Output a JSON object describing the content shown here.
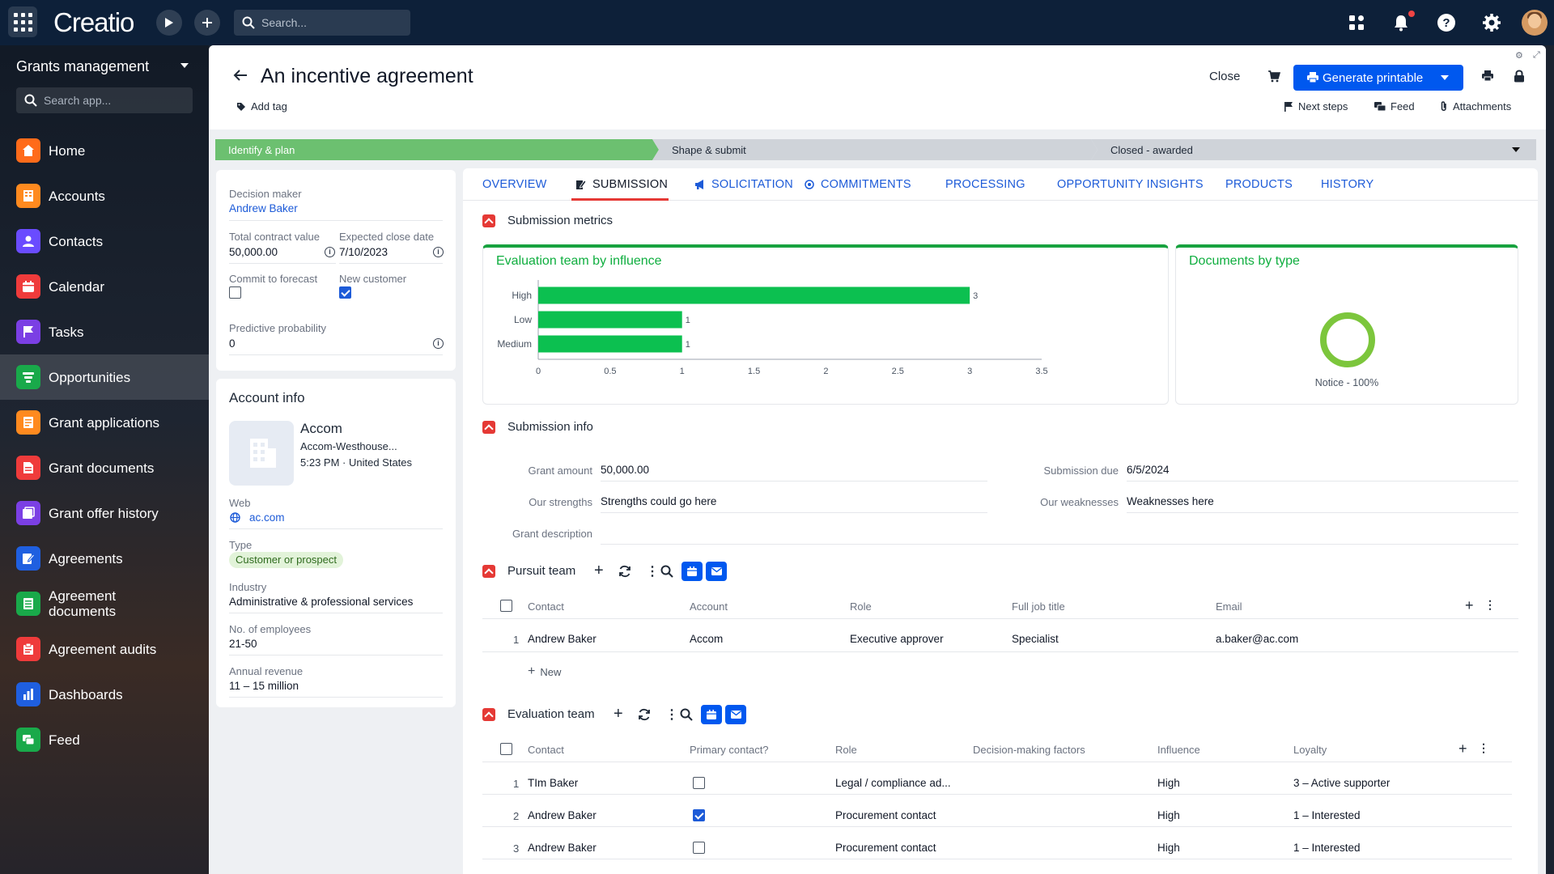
{
  "topbar": {
    "logo": "Creatio",
    "search_placeholder": "Search..."
  },
  "sidebar": {
    "app_name": "Grants management",
    "search_placeholder": "Search app...",
    "items": [
      {
        "label": "Home",
        "icon": "home-icon",
        "color": "#ff6b1a"
      },
      {
        "label": "Accounts",
        "icon": "building-icon",
        "color": "#ff8a1f"
      },
      {
        "label": "Contacts",
        "icon": "person-icon",
        "color": "#6a4cff"
      },
      {
        "label": "Calendar",
        "icon": "calendar-icon",
        "color": "#ef3b3b"
      },
      {
        "label": "Tasks",
        "icon": "flag-icon",
        "color": "#7b3fe4"
      },
      {
        "label": "Opportunities",
        "icon": "funnel-icon",
        "color": "#19a94a"
      },
      {
        "label": "Grant applications",
        "icon": "form-icon",
        "color": "#ff8a1f"
      },
      {
        "label": "Grant documents",
        "icon": "document-icon",
        "color": "#ef3b3b"
      },
      {
        "label": "Grant offer history",
        "icon": "history-icon",
        "color": "#7b3fe4"
      },
      {
        "label": "Agreements",
        "icon": "edit-icon",
        "color": "#1f5fe0"
      },
      {
        "label": "Agreement documents",
        "icon": "doc-list-icon",
        "color": "#19a94a"
      },
      {
        "label": "Agreement audits",
        "icon": "audit-icon",
        "color": "#ef3b3b"
      },
      {
        "label": "Dashboards",
        "icon": "bar-chart-icon",
        "color": "#1f5fe0"
      },
      {
        "label": "Feed",
        "icon": "chat-icon",
        "color": "#19a94a"
      }
    ]
  },
  "header": {
    "title": "An incentive agreement",
    "add_tag": "Add tag",
    "close": "Close",
    "generate": "Generate printable",
    "next_steps": "Next steps",
    "feed": "Feed",
    "attachments": "Attachments"
  },
  "stages": [
    "Identify & plan",
    "Shape & submit",
    "Closed - awarded"
  ],
  "left_panel": {
    "decision_maker_label": "Decision maker",
    "decision_maker": "Andrew Baker",
    "total_contract_label": "Total contract value",
    "total_contract": "50,000.00",
    "expected_close_label": "Expected close date",
    "expected_close": "7/10/2023",
    "commit_label": "Commit to forecast",
    "commit": false,
    "new_customer_label": "New customer",
    "new_customer": true,
    "predictive_label": "Predictive probability",
    "predictive": "0"
  },
  "account_info": {
    "title": "Account info",
    "name": "Accom",
    "subtitle": "Accom-Westhouse...",
    "time_location": "5:23 PM · United States",
    "web_label": "Web",
    "web": "ac.com",
    "type_label": "Type",
    "type": "Customer or prospect",
    "industry_label": "Industry",
    "industry": "Administrative & professional services",
    "employees_label": "No. of employees",
    "employees": "21-50",
    "revenue_label": "Annual revenue",
    "revenue": "11 – 15 million"
  },
  "tabs": [
    "OVERVIEW",
    "SUBMISSION",
    "SOLICITATION",
    "COMMITMENTS",
    "PROCESSING",
    "OPPORTUNITY INSIGHTS",
    "PRODUCTS",
    "HISTORY"
  ],
  "submission_metrics": {
    "title": "Submission metrics",
    "doc_chart_title": "Documents by type",
    "doc_legend": "Notice - 100%"
  },
  "chart_data": [
    {
      "type": "bar",
      "orientation": "horizontal",
      "title": "Evaluation team by influence",
      "categories": [
        "High",
        "Low",
        "Medium"
      ],
      "values": [
        3,
        1,
        1
      ],
      "xlim": [
        0,
        3.5
      ],
      "xticks": [
        "0",
        "0.5",
        "1",
        "1.5",
        "2",
        "2.5",
        "3",
        "3.5"
      ],
      "color": "#0cc050"
    },
    {
      "type": "pie",
      "title": "Documents by type",
      "categories": [
        "Notice"
      ],
      "values": [
        100
      ],
      "color": "#7cc63c"
    }
  ],
  "submission_info": {
    "title": "Submission info",
    "grant_amount_label": "Grant amount",
    "grant_amount": "50,000.00",
    "submission_due_label": "Submission due",
    "submission_due": "6/5/2024",
    "strengths_label": "Our strengths",
    "strengths": "Strengths could go here",
    "weaknesses_label": "Our weaknesses",
    "weaknesses": "Weaknesses here",
    "description_label": "Grant description"
  },
  "pursuit_team": {
    "title": "Pursuit team",
    "columns": [
      "Contact",
      "Account",
      "Role",
      "Full job title",
      "Email"
    ],
    "rows": [
      {
        "num": "1",
        "contact": "Andrew Baker",
        "account": "Accom",
        "role": "Executive approver",
        "job": "Specialist",
        "email": "a.baker@ac.com"
      }
    ],
    "new_label": "New"
  },
  "evaluation_team": {
    "title": "Evaluation team",
    "columns": [
      "Contact",
      "Primary contact?",
      "Role",
      "Decision-making factors",
      "Influence",
      "Loyalty"
    ],
    "rows": [
      {
        "num": "1",
        "contact": "TIm Baker",
        "primary": false,
        "role": "Legal / compliance ad...",
        "influence": "High",
        "loyalty": "3 – Active supporter"
      },
      {
        "num": "2",
        "contact": "Andrew Baker",
        "primary": true,
        "role": "Procurement contact",
        "influence": "High",
        "loyalty": "1 – Interested"
      },
      {
        "num": "3",
        "contact": "Andrew Baker",
        "primary": false,
        "role": "Procurement contact",
        "influence": "High",
        "loyalty": "1 – Interested"
      }
    ]
  }
}
